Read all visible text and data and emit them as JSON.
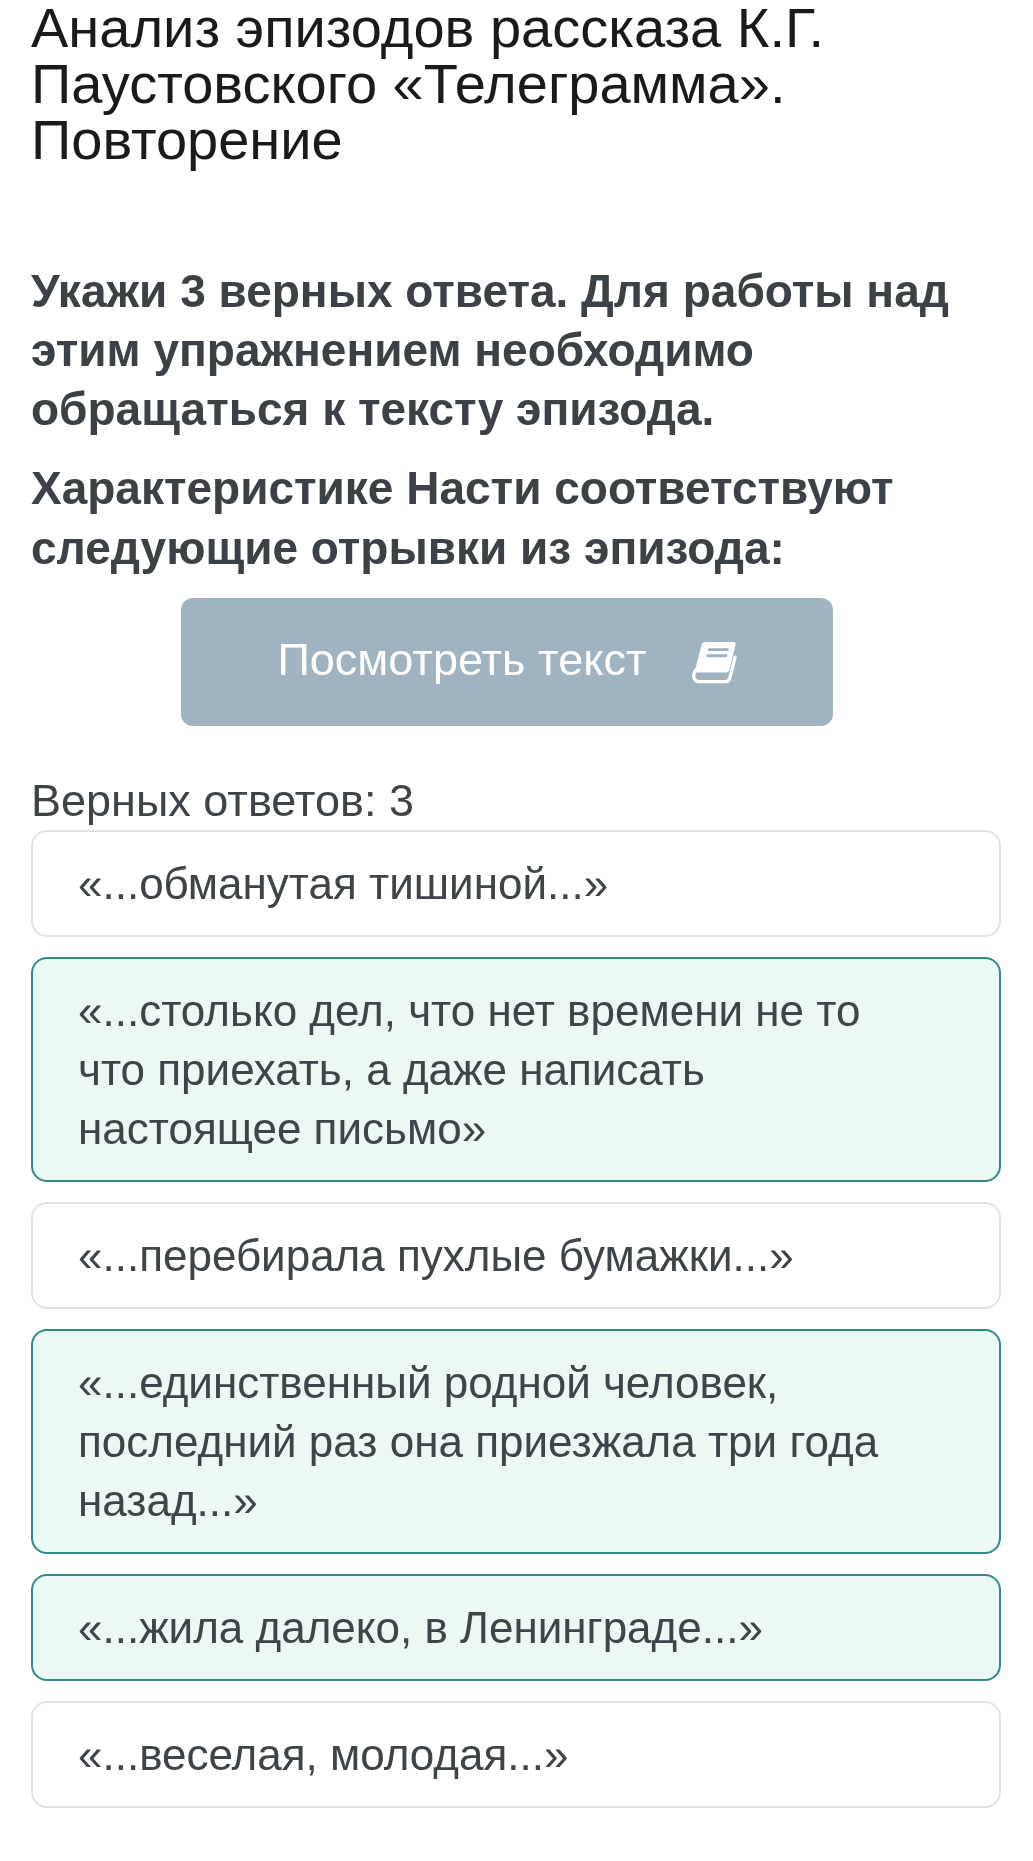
{
  "title": "Анализ эпизодов рассказа К.Г. Паустовского «Телеграмма». Повторение",
  "instruction": "Укажи 3 верных ответа. Для работы над этим упражнением необходимо обращаться к тексту эпизода.",
  "question": "Характеристике Насти соответствуют следующие отрывки из эпизода:",
  "view_text_button": {
    "label": "Посмотреть текст"
  },
  "answers_count": "Верных ответов: 3",
  "options": [
    {
      "text": "«...обманутая тишиной...»",
      "selected": false
    },
    {
      "text": "«...столько дел, что нет времени не то что приехать, а даже написать настоящее письмо»",
      "selected": true
    },
    {
      "text": "«...перебирала пухлые бумажки...»",
      "selected": false
    },
    {
      "text": "«...единственный родной человек, последний раз она приезжала три года назад...»",
      "selected": true
    },
    {
      "text": "«...жила далеко, в Ленинграде...»",
      "selected": true
    },
    {
      "text": "«...веселая, молодая...»",
      "selected": false
    }
  ]
}
